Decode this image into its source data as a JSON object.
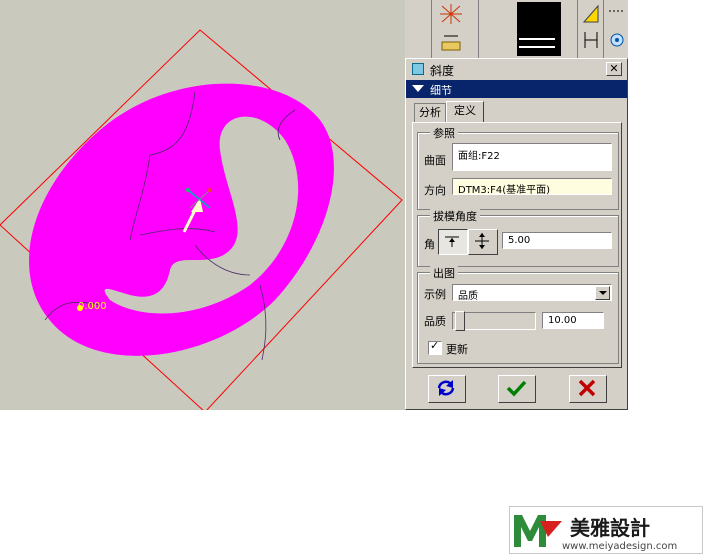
{
  "viewport": {
    "dimension_value": "0.000",
    "colors": {
      "background": "#c9c9bd",
      "part": "#ff00ff",
      "datum": "#ff0000",
      "dimension": "#ffff00"
    }
  },
  "toolbar": {
    "icons": [
      "axes-icon",
      "measure-icon",
      "display-swatch-icon",
      "edit-datum-icon",
      "dimension-icon",
      "more-icon",
      "target-icon"
    ]
  },
  "dialog": {
    "title": "斜度",
    "close_label": "✕",
    "detail_bar": "细节",
    "tabs": [
      {
        "label": "分析",
        "active": false
      },
      {
        "label": "定义",
        "active": true
      }
    ],
    "reference": {
      "legend": "参照",
      "surface_label": "曲面",
      "surface_value": "面组:F22",
      "direction_label": "方向",
      "direction_value": "DTM3:F4(基准平面)"
    },
    "draft_angle": {
      "legend": "拔模角度",
      "angle_label": "角",
      "angle_value": "5.00"
    },
    "output": {
      "legend": "出图",
      "example_label": "示例",
      "example_value": "品质",
      "quality_label": "品质",
      "quality_value": "10.00",
      "quality_level": 0,
      "update_label": "更新",
      "update_checked": true
    },
    "buttons": {
      "repaint": "repaint-icon",
      "ok": "check-icon",
      "cancel": "x-icon",
      "colors": {
        "ok": "#008000",
        "cancel": "#c00000",
        "repaint": "#0000cc"
      }
    }
  },
  "watermark": {
    "brand": "美雅設計",
    "url": "www.meiyadesign.com"
  }
}
